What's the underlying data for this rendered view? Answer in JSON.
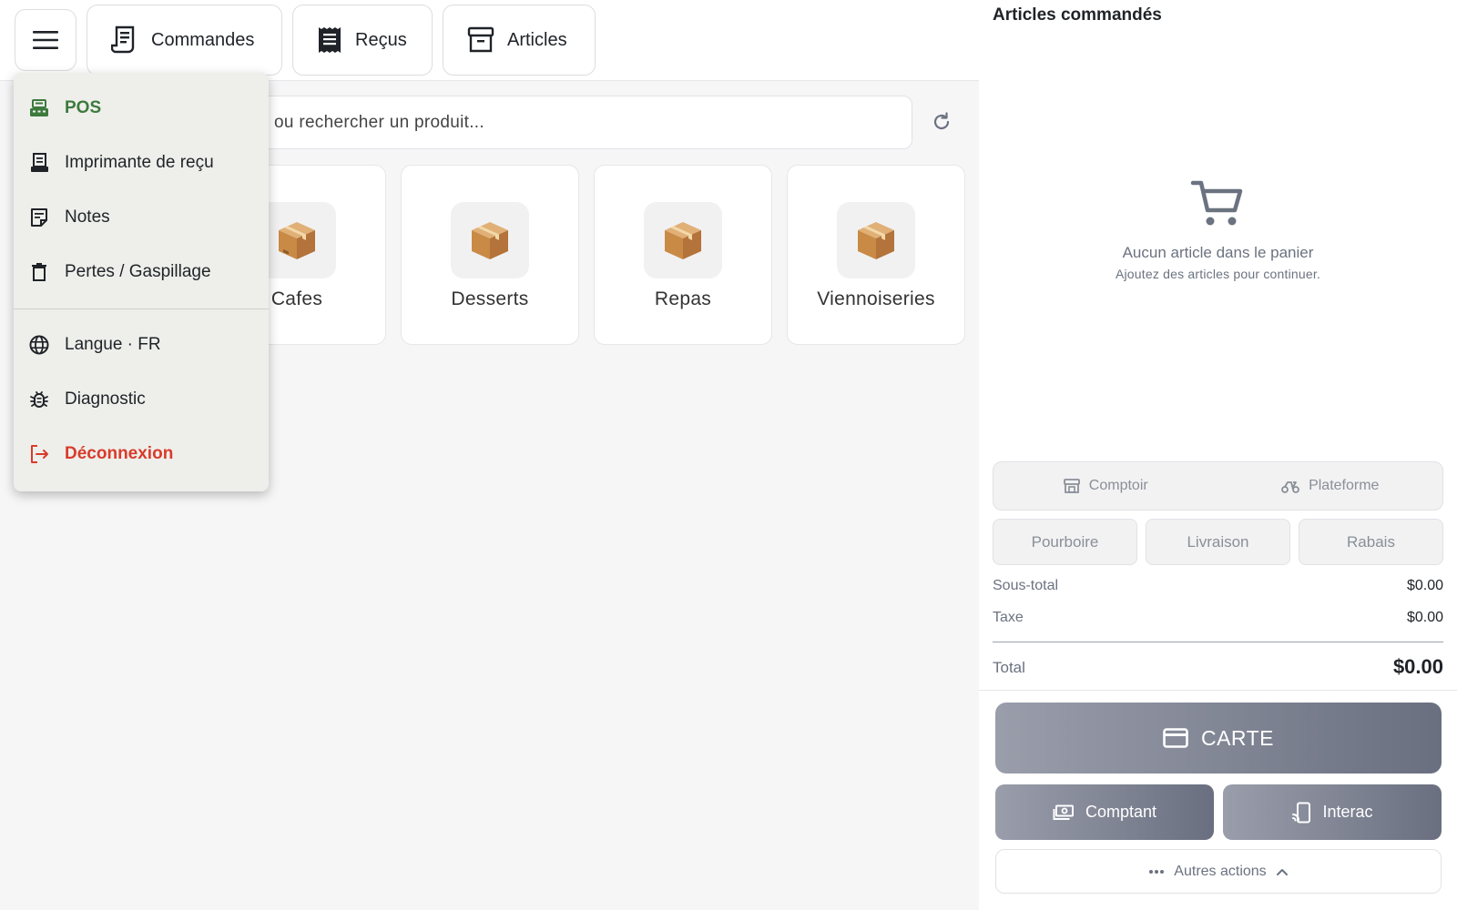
{
  "topbar": {
    "nav": [
      {
        "label": "Commandes",
        "icon": "receipt-long-icon"
      },
      {
        "label": "Reçus",
        "icon": "receipt-icon"
      },
      {
        "label": "Articles",
        "icon": "archive-box-icon"
      }
    ]
  },
  "search": {
    "placeholder": "ou rechercher un produit..."
  },
  "categories": [
    {
      "label": "Cafes",
      "icon": "package-icon"
    },
    {
      "label": "Desserts",
      "icon": "package-icon"
    },
    {
      "label": "Repas",
      "icon": "package-icon"
    },
    {
      "label": "Viennoiseries",
      "icon": "package-icon"
    }
  ],
  "menu": {
    "items": [
      {
        "label": "POS",
        "icon": "cash-register-icon",
        "color": "#3d7a3d"
      },
      {
        "label": "Imprimante de reçu",
        "icon": "receipt-printer-icon",
        "color": "#1f2328"
      },
      {
        "label": "Notes",
        "icon": "note-icon",
        "color": "#1f2328"
      },
      {
        "label": "Pertes / Gaspillage",
        "icon": "trash-icon",
        "color": "#1f2328"
      },
      {
        "label": "Langue · FR",
        "icon": "globe-icon",
        "color": "#1f2328"
      },
      {
        "label": "Diagnostic",
        "icon": "bug-icon",
        "color": "#1f2328"
      },
      {
        "label": "Déconnexion",
        "icon": "logout-icon",
        "color": "#d93b2b"
      }
    ]
  },
  "cart": {
    "title": "Articles commandés",
    "empty_title": "Aucun article dans le panier",
    "empty_subtitle": "Ajoutez des articles pour continuer.",
    "modes": [
      "Comptoir",
      "Plateforme"
    ],
    "extras": [
      "Pourboire",
      "Livraison",
      "Rabais"
    ],
    "subtotal_label": "Sous-total",
    "subtotal_value": "$0.00",
    "tax_label": "Taxe",
    "tax_value": "$0.00",
    "total_label": "Total",
    "total_value": "$0.00"
  },
  "payment": {
    "card_label": "CARTE",
    "cash_label": "Comptant",
    "interac_label": "Interac",
    "more_label": "Autres actions"
  },
  "colors": {
    "accent_green": "#3d7a3d",
    "danger_red": "#d93b2b",
    "pay_gradient_start": "#9a9eab",
    "pay_gradient_end": "#6a6f80"
  }
}
